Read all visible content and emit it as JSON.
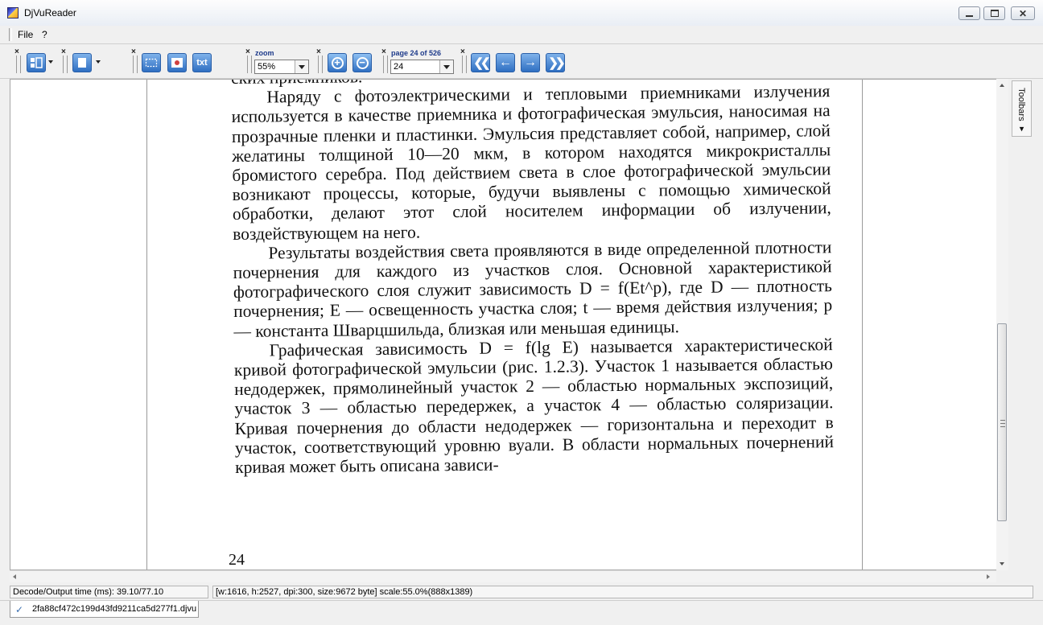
{
  "window": {
    "title": "DjVuReader"
  },
  "menu": {
    "file": "File",
    "help": "?"
  },
  "toolbar": {
    "close_glyph": "×",
    "txt_label": "txt",
    "zoom_label": "zoom",
    "zoom_value": "55%",
    "page_label": "page 24 of 526",
    "page_value": "24"
  },
  "document": {
    "paragraphs": [
      "ских приемников.",
      "Наряду с фотоэлектрическими и тепловыми приемниками излучения используется в качестве приемника и фотографическая эмульсия, наносимая на прозрачные пленки и пластинки. Эмульсия представляет собой, например, слой желатины толщиной 10—20 мкм, в котором находятся микрокристаллы бромистого серебра. Под действием света в слое фотографической эмульсии возникают процессы, которые, будучи выявлены с помощью химической обработки, делают этот слой носителем информации об излучении, воздействующем на него.",
      "Результаты воздействия света проявляются в виде определенной плотности почернения для каждого из участков слоя. Основной характеристикой фотографического слоя служит зависимость D = f(Et^p), где D — плотность почернения; E — освещенность участка слоя; t — время действия излучения; p — константа Шварцшильда, близкая или меньшая единицы.",
      "Графическая зависимость D = f(lg E) называется характеристической кривой фотографической эмульсии (рис. 1.2.3). Участок 1 называется областью недодержек, прямолинейный участок 2 — областью нормальных экспозиций, участок 3 — областью передержек, а участок 4 — областью соляризации. Кривая почернения до области недодержек — горизонтальна и переходит в участок, соответствующий уровню вуали. В области нормальных почернений кривая может быть описана зависи-"
    ],
    "page_number": "24"
  },
  "side_panel": {
    "label": "Toolbars"
  },
  "status": {
    "decode_time": "Decode/Output time (ms): 39.10/77.10",
    "page_info": "[w:1616, h:2527, dpi:300, size:9672 byte] scale:55.0%(888x1389)"
  },
  "tab": {
    "filename": "2fa88cf472c199d43fd9211ca5d277f1.djvu"
  },
  "colors": {
    "accent": "#2f6fc2",
    "toolbar_label": "#1d3a8a"
  }
}
